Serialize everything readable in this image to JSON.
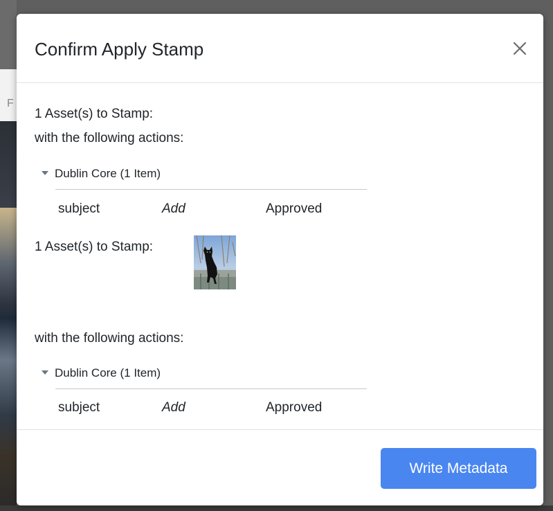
{
  "modal": {
    "title": "Confirm Apply Stamp",
    "write_button": "Write Metadata"
  },
  "groups": [
    {
      "asset_line": "1 Asset(s) to Stamp:",
      "actions_line": "with the following actions:",
      "section_label": "Dublin Core (1 Item)",
      "actions": [
        {
          "field": "subject",
          "op": "Add",
          "value": "Approved"
        }
      ]
    },
    {
      "asset_line": "1 Asset(s) to Stamp:",
      "thumbnail_icon": "black-cat-photo",
      "actions_line": "with the following actions:",
      "section_label": "Dublin Core (1 Item)",
      "actions": [
        {
          "field": "subject",
          "op": "Add",
          "value": "Approved"
        }
      ]
    }
  ],
  "background": {
    "left_letter": "F"
  },
  "colors": {
    "primary": "#4a86f0",
    "text": "#212529",
    "divider": "#dee2e6"
  }
}
